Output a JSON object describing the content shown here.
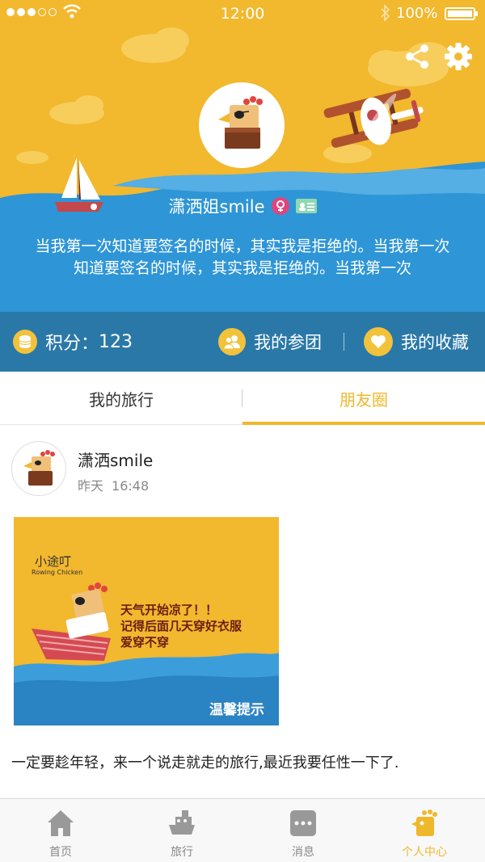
{
  "status_bar": {
    "time": "12:00",
    "battery": "100%"
  },
  "profile": {
    "username": "潇洒姐smile",
    "signature": "当我第一次知道要签名的时候，其实我是拒绝的。当我第一次知道要签名的时候，其实我是拒绝的。当我第一次"
  },
  "stats": {
    "points_label": "积分：",
    "points_value": "123",
    "groups_label": "我的参团",
    "favorites_label": "我的收藏"
  },
  "tabs": [
    {
      "label": "我的旅行",
      "active": false
    },
    {
      "label": "朋友圈",
      "active": true
    }
  ],
  "post": {
    "author": "潇洒smile",
    "time_day": "昨天",
    "time_clock": "16:48",
    "image": {
      "brand": "小途叮",
      "brand_en": "Rowing Chicken",
      "lines": [
        "天气开始凉了！！",
        "记得后面几天穿好衣服",
        "爱穿不穿"
      ],
      "tip": "温馨提示"
    },
    "text": "一定要趁年轻，来一个说走就走的旅行,最近我要任性一下了."
  },
  "bottom_nav": [
    {
      "label": "首页",
      "icon": "home-icon",
      "active": false
    },
    {
      "label": "旅行",
      "icon": "boat-icon",
      "active": false
    },
    {
      "label": "消息",
      "icon": "message-icon",
      "active": false
    },
    {
      "label": "个人中心",
      "icon": "profile-icon",
      "active": true
    }
  ],
  "colors": {
    "header_yellow": "#F2B82E",
    "sea_blue": "#2E95D6",
    "stats_bar": "#2A78A8",
    "accent": "#EFB82C"
  }
}
